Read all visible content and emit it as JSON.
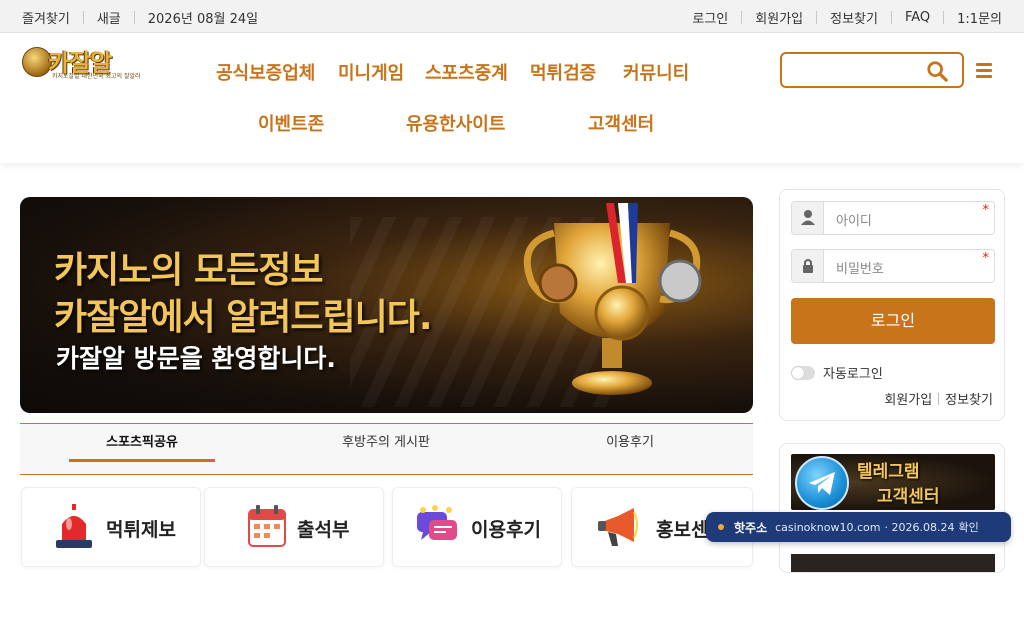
{
  "topbar": {
    "left": [
      "즐겨찾기",
      "새글",
      "2026년 08월 24일"
    ],
    "right": [
      "로그인",
      "회원가입",
      "정보찾기",
      "FAQ",
      "1:1문의"
    ]
  },
  "logo": {
    "text": "카잘알",
    "sub": "카지노잘알 대한민국 최고의 잘알러"
  },
  "nav": {
    "row1": [
      "공식보증업체",
      "미니게임",
      "스포츠중계",
      "먹튀검증",
      "커뮤니티"
    ],
    "row2": [
      "이벤트존",
      "유용한사이트",
      "고객센터"
    ]
  },
  "search": {
    "placeholder": "",
    "icon": "search-icon"
  },
  "banner": {
    "line1": "카지노의 모든정보",
    "line2": "카잘알에서 알려드립니다.",
    "line3": "카잘알 방문을 환영합니다."
  },
  "tabs": [
    "스포츠픽공유",
    "후방주의 게시판",
    "이용후기"
  ],
  "quick_cards": [
    {
      "label": "먹튀제보",
      "icon": "siren-icon"
    },
    {
      "label": "출석부",
      "icon": "calendar-icon"
    },
    {
      "label": "이용후기",
      "icon": "chat-icon"
    },
    {
      "label": "홍보센터",
      "icon": "megaphone-icon"
    }
  ],
  "login": {
    "id_placeholder": "아이디",
    "pw_placeholder": "비밀번호",
    "required_mark": "*",
    "button": "로그인",
    "auto_login": "자동로그인",
    "links": [
      "회원가입",
      "정보찾기"
    ]
  },
  "telegram": {
    "line1": "텔레그램",
    "line2": "고객센터"
  },
  "toast": {
    "key": "핫주소",
    "domain": "casinoknow10.com",
    "date": "· 2026.08.24",
    "confirm": "확인"
  },
  "colors": {
    "accent": "#c8741a",
    "toast_bg": "#1f3a78",
    "banner_gold": "#f3c65a"
  }
}
